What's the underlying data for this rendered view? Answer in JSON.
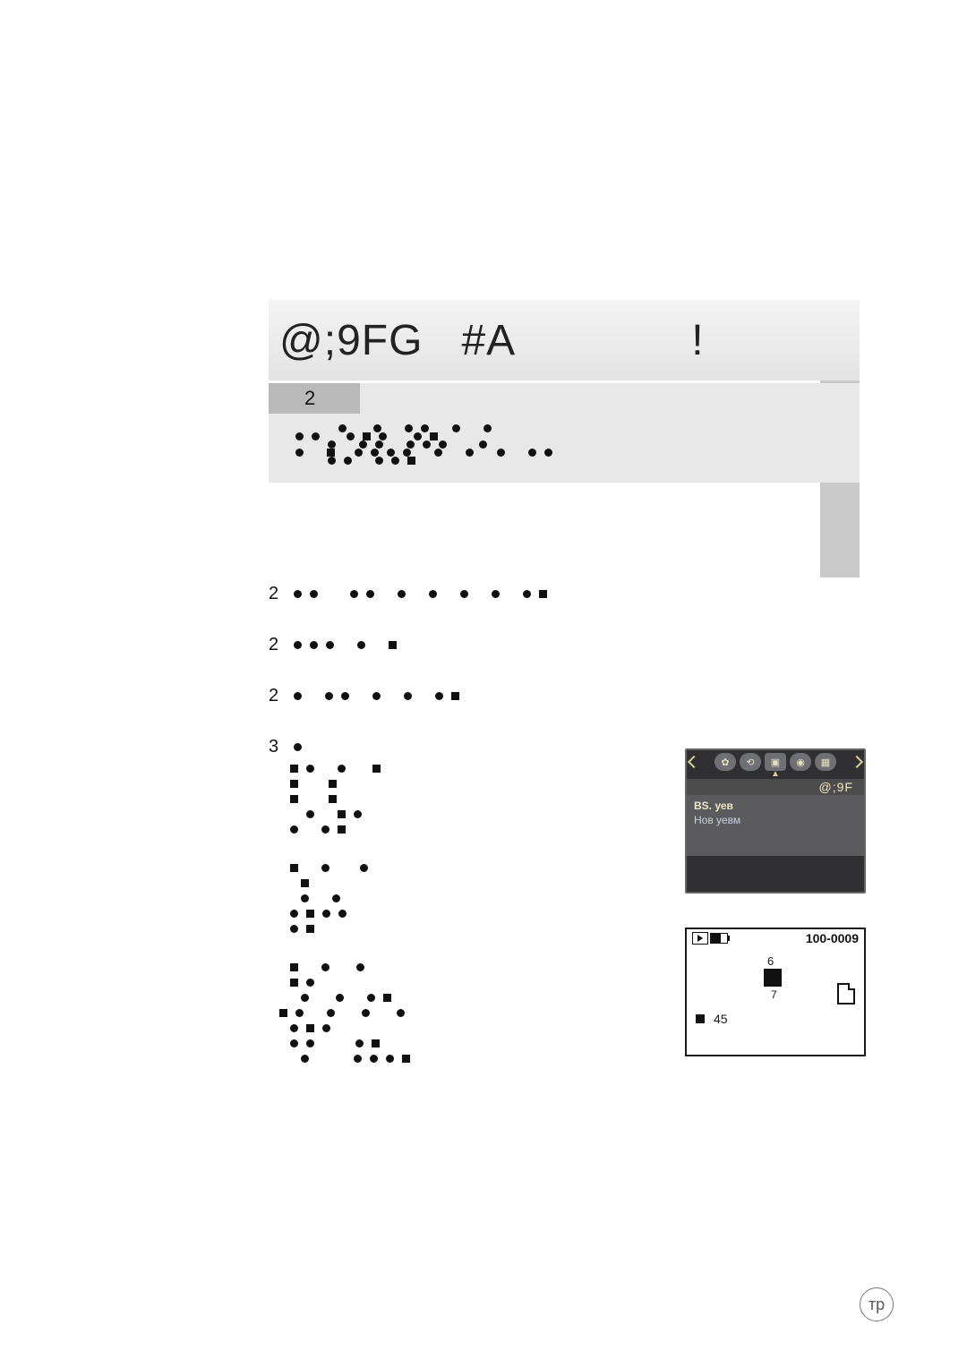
{
  "side_tab": {
    "color": "#c9c9c9"
  },
  "title": {
    "text_left": "@;9FG",
    "text_right": "#A",
    "text_end": "!"
  },
  "info_box": {
    "header": "2"
  },
  "body": {
    "lines": [
      "2",
      "2",
      "2",
      "3"
    ]
  },
  "camera_screen": {
    "title": "@;9F",
    "row_selected": "ВS. уев",
    "row_other": "Нов уевм"
  },
  "preview": {
    "code": "100-0009",
    "num_top": "6",
    "num_bottom": "7",
    "footer_num": "45"
  },
  "page_number": "тр",
  "colors": {
    "title_band_bg": "#ececec",
    "info_bg": "#e8e8e8",
    "info_header_bg": "#b9b9b9",
    "cam_bg": "#303032",
    "cam_body_bg": "#5b5b5d",
    "cam_accent": "#e6e0bc"
  }
}
